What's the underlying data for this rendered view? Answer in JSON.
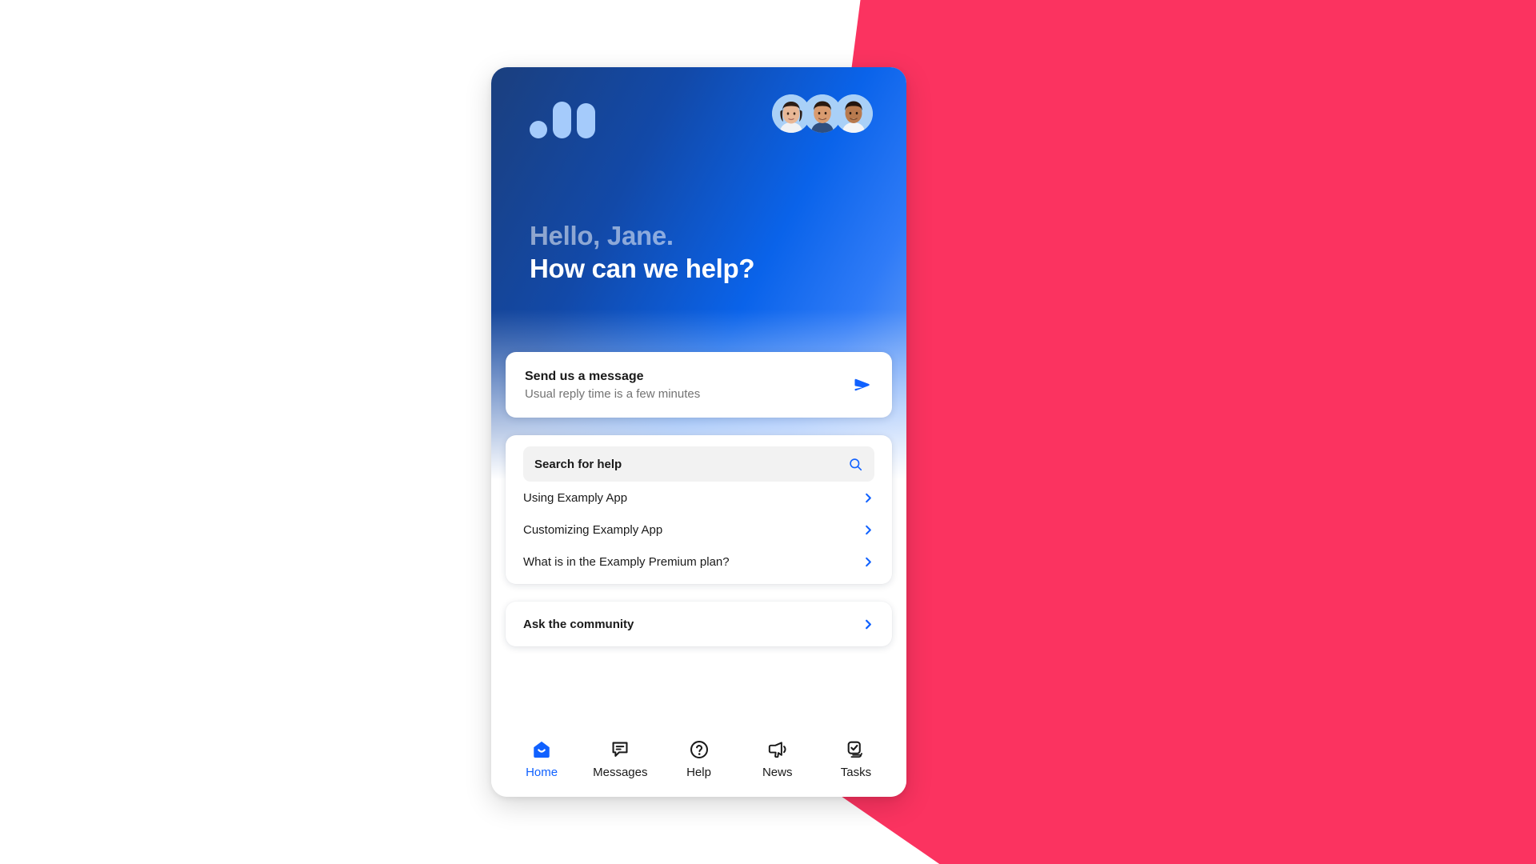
{
  "theme": {
    "accent_red": "#fb3360",
    "brand_blue": "#1061ff",
    "header_gradient_start": "#1b3f7e",
    "header_gradient_end": "#86b2f7",
    "text_dark": "#1a1a1a",
    "text_muted": "#737373"
  },
  "header": {
    "logo_name": "exemply-logo",
    "avatars": [
      {
        "name": "avatar-agent-1",
        "skin": "#e8b796",
        "hair": "#2b1d16",
        "shirt": "#f0f2f5"
      },
      {
        "name": "avatar-agent-2",
        "skin": "#d99b6f",
        "hair": "#2a1a10",
        "shirt": "#2f4f80"
      },
      {
        "name": "avatar-agent-3",
        "skin": "#b87a4e",
        "hair": "#22150e",
        "shirt": "#f3f5f8"
      }
    ],
    "greeting_line1": "Hello, Jane.",
    "greeting_line2": "How can we help?"
  },
  "send_message": {
    "title": "Send us a message",
    "subtitle": "Usual reply time is a few minutes",
    "icon": "send-paper-plane-icon"
  },
  "help": {
    "search_placeholder": "Search for help",
    "search_value": "Search for help",
    "search_icon": "search-icon",
    "items": [
      {
        "label": "Using Examply App"
      },
      {
        "label": "Customizing Examply App"
      },
      {
        "label": "What is in the Examply Premium plan?"
      }
    ]
  },
  "community": {
    "label": "Ask the community",
    "icon": "chevron-right-icon"
  },
  "bottom_nav": {
    "items": [
      {
        "label": "Home",
        "icon": "home-envelope-icon",
        "active": true
      },
      {
        "label": "Messages",
        "icon": "speech-bubble-icon",
        "active": false
      },
      {
        "label": "Help",
        "icon": "question-circle-icon",
        "active": false
      },
      {
        "label": "News",
        "icon": "megaphone-icon",
        "active": false
      },
      {
        "label": "Tasks",
        "icon": "checkbox-stack-icon",
        "active": false
      }
    ]
  }
}
